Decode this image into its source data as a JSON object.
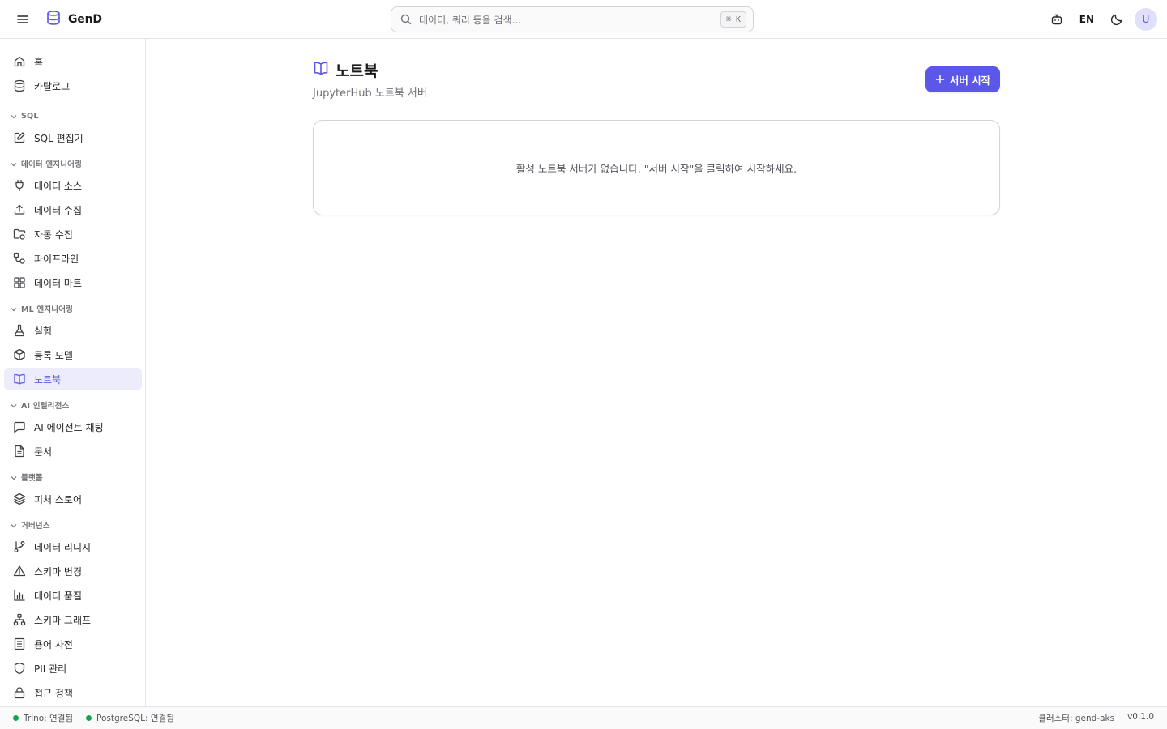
{
  "header": {
    "brand": "GenD",
    "search_placeholder": "데이터, 쿼리 등을 검색...",
    "search_shortcut": "⌘ K",
    "lang": "EN",
    "avatar": "U"
  },
  "sidebar": {
    "top_items": [
      {
        "label": "홈",
        "icon": "home-icon"
      },
      {
        "label": "카탈로그",
        "icon": "database-icon"
      }
    ],
    "sections": [
      {
        "title": "SQL",
        "items": [
          {
            "label": "SQL 편집기",
            "icon": "edit-icon"
          }
        ]
      },
      {
        "title": "데이터 엔지니어링",
        "items": [
          {
            "label": "데이터 소스",
            "icon": "plug-icon"
          },
          {
            "label": "데이터 수집",
            "icon": "upload-icon"
          },
          {
            "label": "자동 수집",
            "icon": "folder-sync-icon"
          },
          {
            "label": "파이프라인",
            "icon": "pipeline-icon"
          },
          {
            "label": "데이터 마트",
            "icon": "grid-icon"
          }
        ]
      },
      {
        "title": "ML 엔지니어링",
        "items": [
          {
            "label": "실험",
            "icon": "flask-icon"
          },
          {
            "label": "등록 모델",
            "icon": "box-icon"
          },
          {
            "label": "노트북",
            "icon": "book-icon",
            "active": true
          }
        ]
      },
      {
        "title": "AI 인텔리전스",
        "items": [
          {
            "label": "AI 에이전트 채팅",
            "icon": "chat-icon"
          },
          {
            "label": "문서",
            "icon": "document-icon"
          }
        ]
      },
      {
        "title": "플랫폼",
        "items": [
          {
            "label": "피처 스토어",
            "icon": "layers-icon"
          }
        ]
      },
      {
        "title": "거버넌스",
        "items": [
          {
            "label": "데이터 리니지",
            "icon": "git-branch-icon"
          },
          {
            "label": "스키마 변경",
            "icon": "warning-icon"
          },
          {
            "label": "데이터 품질",
            "icon": "bar-chart-icon"
          },
          {
            "label": "스키마 그래프",
            "icon": "network-icon"
          },
          {
            "label": "용어 사전",
            "icon": "book-list-icon"
          },
          {
            "label": "PII 관리",
            "icon": "shield-icon"
          },
          {
            "label": "접근 정책",
            "icon": "lock-icon"
          }
        ]
      }
    ]
  },
  "main": {
    "title": "노트북",
    "subtitle": "JupyterHub 노트북 서버",
    "start_button": "서버 시작",
    "empty_message": "활성 노트북 서버가 없습니다. \"서버 시작\"을 클릭하여 시작하세요."
  },
  "status": {
    "trino": "Trino: 연결됨",
    "postgres": "PostgreSQL: 연결됨",
    "cluster": "클러스터: gend-aks",
    "version": "v0.1.0"
  },
  "colors": {
    "accent": "#5b57e8",
    "active_bg": "#ececfd",
    "ok": "#16a34a"
  }
}
